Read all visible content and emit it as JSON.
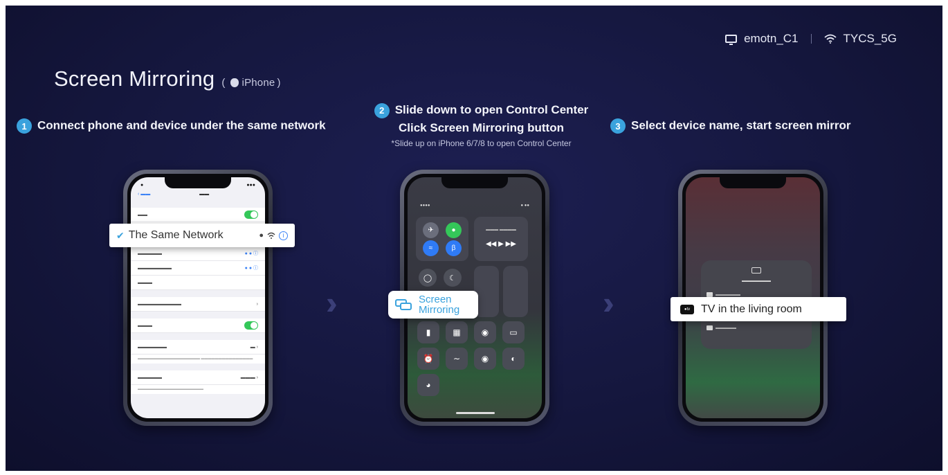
{
  "status": {
    "device_name": "emotn_C1",
    "network_name": "TYCS_5G",
    "device_icon": "tv-icon",
    "network_icon": "wifi-icon"
  },
  "title": {
    "main": "Screen Mirroring",
    "open_paren": "(",
    "platform": "iPhone",
    "close_paren": ")"
  },
  "steps": [
    {
      "number": "1",
      "text": "Connect phone and device under the same network"
    },
    {
      "number": "2",
      "line1": "Slide down to open Control Center",
      "line2": "Click Screen Mirroring button",
      "note": "*Slide up on iPhone 6/7/8 to open Control Center"
    },
    {
      "number": "3",
      "text": "Select device name, start screen mirror"
    }
  ],
  "callouts": {
    "network": "The Same Network",
    "mirroring_line1": "Screen",
    "mirroring_line2": "Mirroring",
    "device": "TV in the living room"
  },
  "colors": {
    "accent": "#3aa2dd",
    "background": "#15173e"
  }
}
